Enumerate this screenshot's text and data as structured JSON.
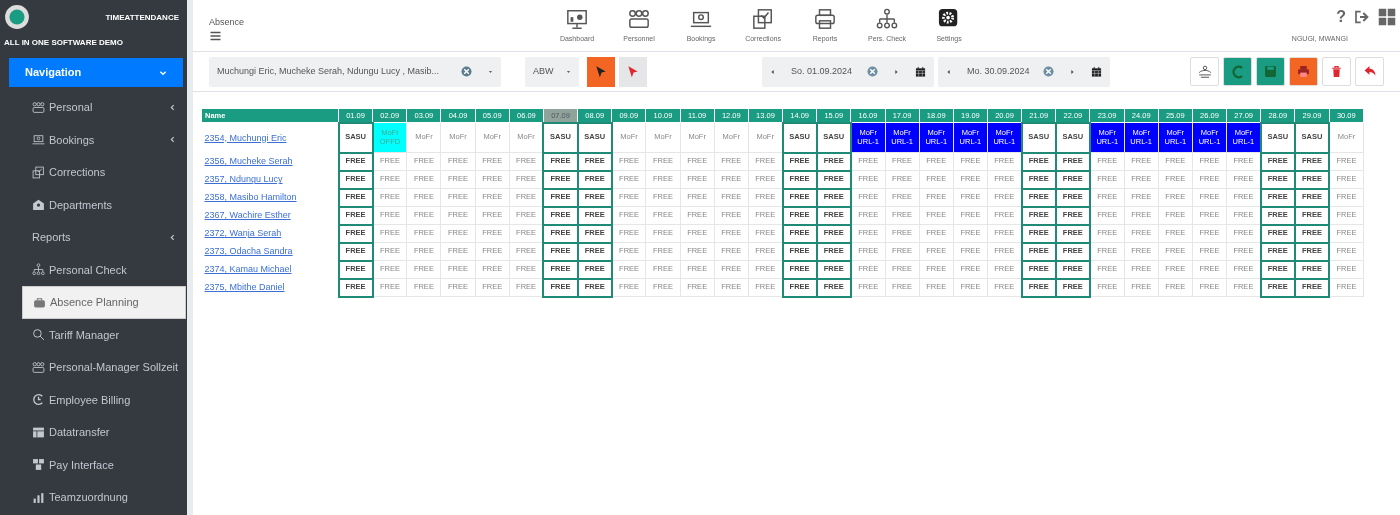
{
  "brand": {
    "product": "TIMEATTENDANCE",
    "company": "ALL IN ONE SOFTWARE DEMO"
  },
  "sidebar": {
    "header": {
      "label": "Navigation",
      "expanded": true
    },
    "items": [
      {
        "label": "Personal",
        "submenu": true,
        "selected": false
      },
      {
        "label": "Bookings",
        "submenu": true,
        "selected": false
      },
      {
        "label": "Corrections",
        "submenu": false,
        "selected": false
      },
      {
        "label": "Departments",
        "submenu": false,
        "selected": false
      },
      {
        "label": "Reports",
        "submenu": true,
        "selected": false
      },
      {
        "label": "Personal Check",
        "submenu": false,
        "selected": false
      },
      {
        "label": "Absence Planning",
        "submenu": false,
        "selected": true
      },
      {
        "label": "Tariff Manager",
        "submenu": false,
        "selected": false
      },
      {
        "label": "Personal-Manager Sollzeit",
        "submenu": false,
        "selected": false
      },
      {
        "label": "Employee Billing",
        "submenu": false,
        "selected": false
      },
      {
        "label": "Datatransfer",
        "submenu": false,
        "selected": false
      },
      {
        "label": "Pay Interface",
        "submenu": false,
        "selected": false
      },
      {
        "label": "Teamzuordnung",
        "submenu": false,
        "selected": false
      }
    ]
  },
  "page_title": "Absence",
  "toolbar": [
    {
      "label": "Dashboard"
    },
    {
      "label": "Personnel"
    },
    {
      "label": "Bookings"
    },
    {
      "label": "Corrections"
    },
    {
      "label": "Reports"
    },
    {
      "label": "Pers. Check"
    },
    {
      "label": "Settings"
    }
  ],
  "help": "?",
  "user": "NGUGI, MWANGI",
  "filters": {
    "employees": "Muchungi Eric, Mucheke Serah, Ndungu Lucy , Masib...",
    "absence_type": "ABW",
    "pick_buttons": [
      {
        "selected": true
      },
      {
        "selected": false
      }
    ],
    "date_from": "So. 01.09.2024",
    "date_to": "Mo. 30.09.2024"
  },
  "actions": [
    {
      "color": "#ffffff"
    },
    {
      "color": "#1a9c82"
    },
    {
      "color": "#1a9c82"
    },
    {
      "color": "#f26522"
    },
    {
      "color": "#ffffff"
    },
    {
      "color": "#ffffff"
    }
  ],
  "table": {
    "name_header": "Name",
    "days": [
      {
        "label": "01.09",
        "weekend": true,
        "today": false
      },
      {
        "label": "02.09",
        "weekend": false,
        "today": false
      },
      {
        "label": "03.09",
        "weekend": false,
        "today": false
      },
      {
        "label": "04.09",
        "weekend": false,
        "today": false
      },
      {
        "label": "05.09",
        "weekend": false,
        "today": false
      },
      {
        "label": "06.09",
        "weekend": false,
        "today": false
      },
      {
        "label": "07.09",
        "weekend": true,
        "today": true
      },
      {
        "label": "08.09",
        "weekend": true,
        "today": false
      },
      {
        "label": "09.09",
        "weekend": false,
        "today": false
      },
      {
        "label": "10.09",
        "weekend": false,
        "today": false
      },
      {
        "label": "11.09",
        "weekend": false,
        "today": false
      },
      {
        "label": "12.09",
        "weekend": false,
        "today": false
      },
      {
        "label": "13.09",
        "weekend": false,
        "today": false
      },
      {
        "label": "14.09",
        "weekend": true,
        "today": false
      },
      {
        "label": "15.09",
        "weekend": true,
        "today": false
      },
      {
        "label": "16.09",
        "weekend": false,
        "today": false
      },
      {
        "label": "17.09",
        "weekend": false,
        "today": false
      },
      {
        "label": "18.09",
        "weekend": false,
        "today": false
      },
      {
        "label": "19.09",
        "weekend": false,
        "today": false
      },
      {
        "label": "20.09",
        "weekend": false,
        "today": false
      },
      {
        "label": "21.09",
        "weekend": true,
        "today": false
      },
      {
        "label": "22.09",
        "weekend": true,
        "today": false
      },
      {
        "label": "23.09",
        "weekend": false,
        "today": false
      },
      {
        "label": "24.09",
        "weekend": false,
        "today": false
      },
      {
        "label": "25.09",
        "weekend": false,
        "today": false
      },
      {
        "label": "26.09",
        "weekend": false,
        "today": false
      },
      {
        "label": "27.09",
        "weekend": false,
        "today": false
      },
      {
        "label": "28.09",
        "weekend": true,
        "today": false
      },
      {
        "label": "29.09",
        "weekend": true,
        "today": false
      },
      {
        "label": "30.09",
        "weekend": false,
        "today": false
      }
    ],
    "rows": [
      {
        "name": "2354, Muchungi Eric",
        "cells": [
          {
            "text": "SASU",
            "kind": "plain"
          },
          {
            "text": "MoFr\nOFFD",
            "kind": "offday"
          },
          {
            "text": "MoFr",
            "kind": "plain"
          },
          {
            "text": "MoFr",
            "kind": "plain"
          },
          {
            "text": "MoFr",
            "kind": "plain"
          },
          {
            "text": "MoFr",
            "kind": "plain"
          },
          {
            "text": "SASU",
            "kind": "plain"
          },
          {
            "text": "SASU",
            "kind": "plain"
          },
          {
            "text": "MoFr",
            "kind": "plain"
          },
          {
            "text": "MoFr",
            "kind": "plain"
          },
          {
            "text": "MoFr",
            "kind": "plain"
          },
          {
            "text": "MoFr",
            "kind": "plain"
          },
          {
            "text": "MoFr",
            "kind": "plain"
          },
          {
            "text": "SASU",
            "kind": "plain"
          },
          {
            "text": "SASU",
            "kind": "plain"
          },
          {
            "text": "MoFr\nURL-1",
            "kind": "vacation"
          },
          {
            "text": "MoFr\nURL-1",
            "kind": "vacation"
          },
          {
            "text": "MoFr\nURL-1",
            "kind": "vacation"
          },
          {
            "text": "MoFr\nURL-1",
            "kind": "vacation"
          },
          {
            "text": "MoFr\nURL-1",
            "kind": "vacation"
          },
          {
            "text": "SASU",
            "kind": "plain"
          },
          {
            "text": "SASU",
            "kind": "plain"
          },
          {
            "text": "MoFr\nURL-1",
            "kind": "vacation"
          },
          {
            "text": "MoFr\nURL-1",
            "kind": "vacation"
          },
          {
            "text": "MoFr\nURL-1",
            "kind": "vacation"
          },
          {
            "text": "MoFr\nURL-1",
            "kind": "vacation"
          },
          {
            "text": "MoFr\nURL-1",
            "kind": "vacation"
          },
          {
            "text": "SASU",
            "kind": "plain"
          },
          {
            "text": "SASU",
            "kind": "plain"
          },
          {
            "text": "MoFr",
            "kind": "plain"
          }
        ]
      },
      {
        "name": "2356, Mucheke Serah",
        "cells": [
          "FREE",
          "FREE",
          "FREE",
          "FREE",
          "FREE",
          "FREE",
          "FREE",
          "FREE",
          "FREE",
          "FREE",
          "FREE",
          "FREE",
          "FREE",
          "FREE",
          "FREE",
          "FREE",
          "FREE",
          "FREE",
          "FREE",
          "FREE",
          "FREE",
          "FREE",
          "FREE",
          "FREE",
          "FREE",
          "FREE",
          "FREE",
          "FREE",
          "FREE",
          "FREE"
        ]
      },
      {
        "name": "2357, Ndungu Lucy",
        "cells": [
          "FREE",
          "FREE",
          "FREE",
          "FREE",
          "FREE",
          "FREE",
          "FREE",
          "FREE",
          "FREE",
          "FREE",
          "FREE",
          "FREE",
          "FREE",
          "FREE",
          "FREE",
          "FREE",
          "FREE",
          "FREE",
          "FREE",
          "FREE",
          "FREE",
          "FREE",
          "FREE",
          "FREE",
          "FREE",
          "FREE",
          "FREE",
          "FREE",
          "FREE",
          "FREE"
        ]
      },
      {
        "name": "2358, Masibo Hamilton",
        "cells": [
          "FREE",
          "FREE",
          "FREE",
          "FREE",
          "FREE",
          "FREE",
          "FREE",
          "FREE",
          "FREE",
          "FREE",
          "FREE",
          "FREE",
          "FREE",
          "FREE",
          "FREE",
          "FREE",
          "FREE",
          "FREE",
          "FREE",
          "FREE",
          "FREE",
          "FREE",
          "FREE",
          "FREE",
          "FREE",
          "FREE",
          "FREE",
          "FREE",
          "FREE",
          "FREE"
        ]
      },
      {
        "name": "2367, Wachire Esther",
        "cells": [
          "FREE",
          "FREE",
          "FREE",
          "FREE",
          "FREE",
          "FREE",
          "FREE",
          "FREE",
          "FREE",
          "FREE",
          "FREE",
          "FREE",
          "FREE",
          "FREE",
          "FREE",
          "FREE",
          "FREE",
          "FREE",
          "FREE",
          "FREE",
          "FREE",
          "FREE",
          "FREE",
          "FREE",
          "FREE",
          "FREE",
          "FREE",
          "FREE",
          "FREE",
          "FREE"
        ]
      },
      {
        "name": "2372, Wanja Serah",
        "cells": [
          "FREE",
          "FREE",
          "FREE",
          "FREE",
          "FREE",
          "FREE",
          "FREE",
          "FREE",
          "FREE",
          "FREE",
          "FREE",
          "FREE",
          "FREE",
          "FREE",
          "FREE",
          "FREE",
          "FREE",
          "FREE",
          "FREE",
          "FREE",
          "FREE",
          "FREE",
          "FREE",
          "FREE",
          "FREE",
          "FREE",
          "FREE",
          "FREE",
          "FREE",
          "FREE"
        ]
      },
      {
        "name": "2373, Odacha Sandra",
        "cells": [
          "FREE",
          "FREE",
          "FREE",
          "FREE",
          "FREE",
          "FREE",
          "FREE",
          "FREE",
          "FREE",
          "FREE",
          "FREE",
          "FREE",
          "FREE",
          "FREE",
          "FREE",
          "FREE",
          "FREE",
          "FREE",
          "FREE",
          "FREE",
          "FREE",
          "FREE",
          "FREE",
          "FREE",
          "FREE",
          "FREE",
          "FREE",
          "FREE",
          "FREE",
          "FREE"
        ]
      },
      {
        "name": "2374, Kamau Michael",
        "cells": [
          "FREE",
          "FREE",
          "FREE",
          "FREE",
          "FREE",
          "FREE",
          "FREE",
          "FREE",
          "FREE",
          "FREE",
          "FREE",
          "FREE",
          "FREE",
          "FREE",
          "FREE",
          "FREE",
          "FREE",
          "FREE",
          "FREE",
          "FREE",
          "FREE",
          "FREE",
          "FREE",
          "FREE",
          "FREE",
          "FREE",
          "FREE",
          "FREE",
          "FREE",
          "FREE"
        ]
      },
      {
        "name": "2375, Mbithe Daniel",
        "cells": [
          "FREE",
          "FREE",
          "FREE",
          "FREE",
          "FREE",
          "FREE",
          "FREE",
          "FREE",
          "FREE",
          "FREE",
          "FREE",
          "FREE",
          "FREE",
          "FREE",
          "FREE",
          "FREE",
          "FREE",
          "FREE",
          "FREE",
          "FREE",
          "FREE",
          "FREE",
          "FREE",
          "FREE",
          "FREE",
          "FREE",
          "FREE",
          "FREE",
          "FREE",
          "FREE"
        ]
      }
    ]
  }
}
